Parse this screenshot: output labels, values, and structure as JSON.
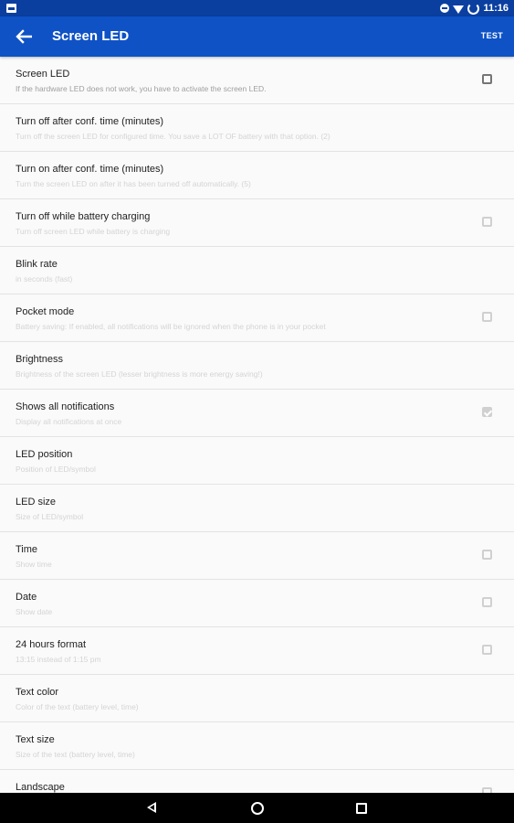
{
  "status_bar": {
    "time": "11:16"
  },
  "app_bar": {
    "title": "Screen LED",
    "action_label": "TEST"
  },
  "settings": [
    {
      "title": "Screen LED",
      "summary": "If the hardware LED does not work, you have to activate the screen LED.",
      "checkbox": true,
      "checked": false,
      "enabled": true
    },
    {
      "title": "Turn off after conf. time (minutes)",
      "summary": "Turn off the screen LED for configured time. You save a LOT OF battery with that option. (2)",
      "checkbox": false,
      "checked": false,
      "enabled": false
    },
    {
      "title": "Turn on after conf. time (minutes)",
      "summary": "Turn the screen LED on after it has been turned off automatically. (5)",
      "checkbox": false,
      "checked": false,
      "enabled": false
    },
    {
      "title": "Turn off while battery charging",
      "summary": "Turn off screen LED while battery is charging",
      "checkbox": true,
      "checked": false,
      "enabled": false
    },
    {
      "title": "Blink rate",
      "summary": "in seconds (fast)",
      "checkbox": false,
      "checked": false,
      "enabled": false
    },
    {
      "title": "Pocket mode",
      "summary": "Battery saving: If enabled, all notifications will be ignored when the phone is in your pocket",
      "checkbox": true,
      "checked": false,
      "enabled": false
    },
    {
      "title": "Brightness",
      "summary": "Brightness of the screen LED (lesser brightness is more energy saving!)",
      "checkbox": false,
      "checked": false,
      "enabled": false
    },
    {
      "title": "Shows all notifications",
      "summary": "Display all notifications at once",
      "checkbox": true,
      "checked": true,
      "enabled": false
    },
    {
      "title": "LED position",
      "summary": "Position of LED/symbol",
      "checkbox": false,
      "checked": false,
      "enabled": false
    },
    {
      "title": "LED size",
      "summary": "Size of LED/symbol",
      "checkbox": false,
      "checked": false,
      "enabled": false
    },
    {
      "title": "Time",
      "summary": "Show time",
      "checkbox": true,
      "checked": false,
      "enabled": false
    },
    {
      "title": "Date",
      "summary": "Show date",
      "checkbox": true,
      "checked": false,
      "enabled": false
    },
    {
      "title": "24 hours format",
      "summary": "13:15 instead of 1:15 pm",
      "checkbox": true,
      "checked": false,
      "enabled": false
    },
    {
      "title": "Text color",
      "summary": "Color of the text (battery level, time)",
      "checkbox": false,
      "checked": false,
      "enabled": false
    },
    {
      "title": "Text size",
      "summary": "Size of the text (battery level, time)",
      "checkbox": false,
      "checked": false,
      "enabled": false
    },
    {
      "title": "Landscape",
      "summary": "",
      "checkbox": true,
      "checked": false,
      "enabled": false
    }
  ],
  "icons": {
    "back": "arrow-back-icon",
    "nav_back": "nav-back-icon",
    "nav_home": "nav-home-icon",
    "nav_recents": "nav-recents-icon"
  },
  "colors": {
    "status_bar": "#0a3fa0",
    "app_bar": "#0e52c6",
    "background": "#fafafa"
  }
}
